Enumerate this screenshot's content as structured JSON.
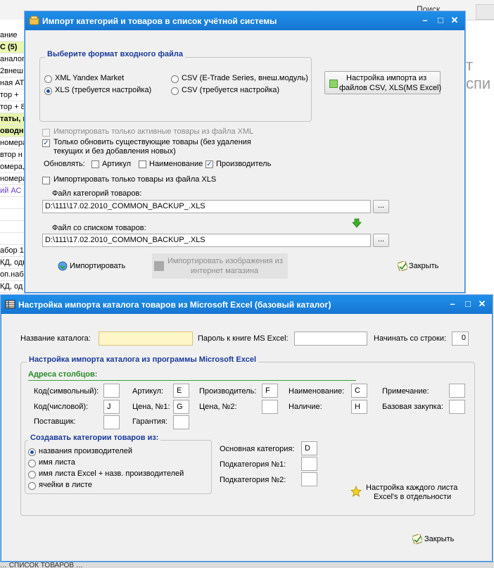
{
  "background": {
    "search_label": "Поиск",
    "left_rows": [
      "ание",
      "С (5)",
      "аналог",
      "2внеш",
      "ная АТ",
      "тор +",
      "тор + 8",
      "таты, п",
      "оводн",
      "номера",
      "втор н",
      "омера,",
      "номера",
      "ий АС",
      "",
      "",
      "",
      "",
      "абор 1",
      "КД, одн",
      "оп.набо",
      "КД, од"
    ],
    "right_text": "т спи",
    "bottom_text": "… СПИСОК ТОВАРОВ …"
  },
  "import_window": {
    "title": "Импорт категорий и товаров в список учётной системы",
    "format_group_title": "Выберите формат входного файла",
    "formats": [
      {
        "label": "XML Yandex Market",
        "selected": false
      },
      {
        "label": "XLS (требуется настройка)",
        "selected": true
      },
      {
        "label": "CSV (E-Trade Series, внеш.модуль)",
        "selected": false
      },
      {
        "label": "CSV (требуется настройка)",
        "selected": false
      }
    ],
    "setup_button_line1": "Настройка импорта из",
    "setup_button_line2": "файлов CSV, XLS(MS Excel)",
    "only_active_xml": "Импортировать только активные товары из файла XML",
    "only_update_line1": "Только обновить существующие товары (без удаления",
    "only_update_line2": "текущих и без добавления новых)",
    "update_label": "Обновлять:",
    "update_article": "Артикул",
    "update_name": "Наименование",
    "update_producer": "Производитель",
    "only_xls": "Импортировать только товары из файла XLS",
    "categories_file_label": "Файл категорий  товаров:",
    "categories_file_value": "D:\\111\\17.02.2010_COMMON_BACKUP_.XLS",
    "products_file_label": "Файл со списком товаров:",
    "products_file_value": "D:\\111\\17.02.2010_COMMON_BACKUP_.XLS",
    "browse": "...",
    "import_button": "Импортировать",
    "import_images_line1": "Импортировать изображения из",
    "import_images_line2": "интернет магазина",
    "close_button": "Закрыть",
    "accent": "#1a3a9a"
  },
  "excel_window": {
    "title": "Настройка импорта каталога товаров из Microsoft Excel (базовый каталог)",
    "catalog_name_label": "Название каталога:",
    "catalog_name_value": "",
    "password_label": "Пароль к книге MS Excel:",
    "password_value": "",
    "start_row_label": "Начинать со строки:",
    "start_row_value": "0",
    "settings_group_title": "Настройка импорта каталога из программы Microsoft Excel",
    "columns_title": "Адреса столбцов:",
    "columns": {
      "code_symbolic": {
        "label": "Код(символьный):",
        "value": ""
      },
      "code_numeric": {
        "label": "Код(числовой):",
        "value": "J"
      },
      "supplier": {
        "label": "Поставщик:",
        "value": ""
      },
      "article": {
        "label": "Артикул:",
        "value": "E"
      },
      "price1": {
        "label": "Цена, №1:",
        "value": "G"
      },
      "warranty": {
        "label": "Гарантия:",
        "value": ""
      },
      "producer": {
        "label": "Производитель:",
        "value": "F"
      },
      "price2": {
        "label": "Цена, №2:",
        "value": ""
      },
      "name": {
        "label": "Наименование:",
        "value": "C"
      },
      "availability": {
        "label": "Наличие:",
        "value": "H"
      },
      "note": {
        "label": "Примечание:",
        "value": ""
      },
      "base_purchase": {
        "label": "Базовая закупка:",
        "value": ""
      }
    },
    "create_group_title": "Создавать категории товаров из:",
    "create_options": [
      {
        "label": "названия производителей",
        "selected": true
      },
      {
        "label": "имя листа",
        "selected": false
      },
      {
        "label": "имя листа Excel + назв. производителей",
        "selected": false
      },
      {
        "label": "ячейки в листе",
        "selected": false
      }
    ],
    "main_category_label": "Основная категория:",
    "main_category_value": "D",
    "subcategory1_label": "Подкатегория №1:",
    "subcategory1_value": "",
    "subcategory2_label": "Подкатегория №2:",
    "subcategory2_value": "",
    "per_sheet_line1": "Настройка каждого листа",
    "per_sheet_line2": "Excel's в отдельности",
    "close_button": "Закрыть",
    "columns_accent": "#2a8a2a"
  }
}
